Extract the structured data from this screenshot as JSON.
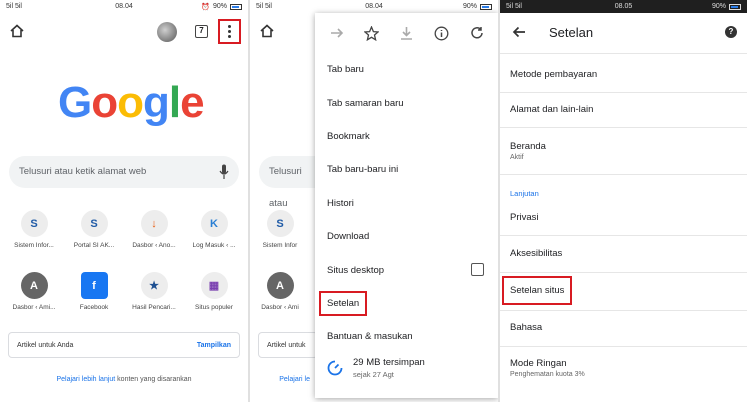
{
  "status_bars": {
    "left_signal": "5il 5il",
    "time_1": "08.04",
    "time_2": "08.04",
    "time_3": "08.05",
    "battery": "90%"
  },
  "panel1": {
    "tab_count": "7",
    "logo": {
      "letters": [
        "G",
        "o",
        "o",
        "g",
        "l",
        "e"
      ],
      "colors": [
        "#4285F4",
        "#EA4335",
        "#FBBC05",
        "#4285F4",
        "#34A853",
        "#EA4335"
      ]
    },
    "search_placeholder": "Telusuri atau ketik alamat web",
    "tiles": [
      {
        "label": "Sistem Infor...",
        "icon": "S",
        "color": "#1f5aa6"
      },
      {
        "label": "Portal SI AK...",
        "icon": "S",
        "color": "#1f5aa6"
      },
      {
        "label": "Dasbor ‹ Ano...",
        "icon": "↓",
        "color": "#e8590c"
      },
      {
        "label": "Log Masuk ‹ ...",
        "icon": "K",
        "color": "#2a7fd4"
      },
      {
        "label": "Dasbor ‹ Ami...",
        "icon": "A",
        "color": "#666666"
      },
      {
        "label": "Facebook",
        "icon": "f",
        "color": "#1877f2"
      },
      {
        "label": "Hasil Pencari...",
        "icon": "★",
        "color": "#1d4f91"
      },
      {
        "label": "Situs populer",
        "icon": "▦",
        "color": "#7a3fb0"
      }
    ],
    "article_label": "Artikel untuk Anda",
    "article_action": "Tampilkan",
    "learn_more_link": "Pelajari lebih lanjut",
    "learn_more_rest": " konten yang disarankan"
  },
  "panel2": {
    "search_placeholder": "Telusuri atau",
    "tiles_labels": [
      "Sistem Infor",
      "Portal SI AK",
      "Dasbor ‹ Ami"
    ],
    "article_label": "Artikel untuk",
    "learn_more_link": "Pelajari le",
    "menu_items": [
      "Tab baru",
      "Tab samaran baru",
      "Bookmark",
      "Tab baru-baru ini",
      "Histori",
      "Download",
      "Situs desktop",
      "Setelan",
      "Bantuan & masukan"
    ],
    "saved_main": "29 MB tersimpan",
    "saved_sub": "sejak 27 Agt"
  },
  "panel3": {
    "title": "Setelan",
    "items": [
      {
        "label": "Metode pembayaran",
        "sub": ""
      },
      {
        "label": "Alamat dan lain-lain",
        "sub": ""
      },
      {
        "label": "Beranda",
        "sub": "Aktif"
      },
      {
        "label": "Lanjutan",
        "sub": ""
      },
      {
        "label": "Privasi",
        "sub": ""
      },
      {
        "label": "Aksesibilitas",
        "sub": ""
      },
      {
        "label": "Setelan situs",
        "sub": ""
      },
      {
        "label": "Bahasa",
        "sub": ""
      },
      {
        "label": "Mode Ringan",
        "sub": "Penghematan kuota 3%"
      }
    ]
  }
}
